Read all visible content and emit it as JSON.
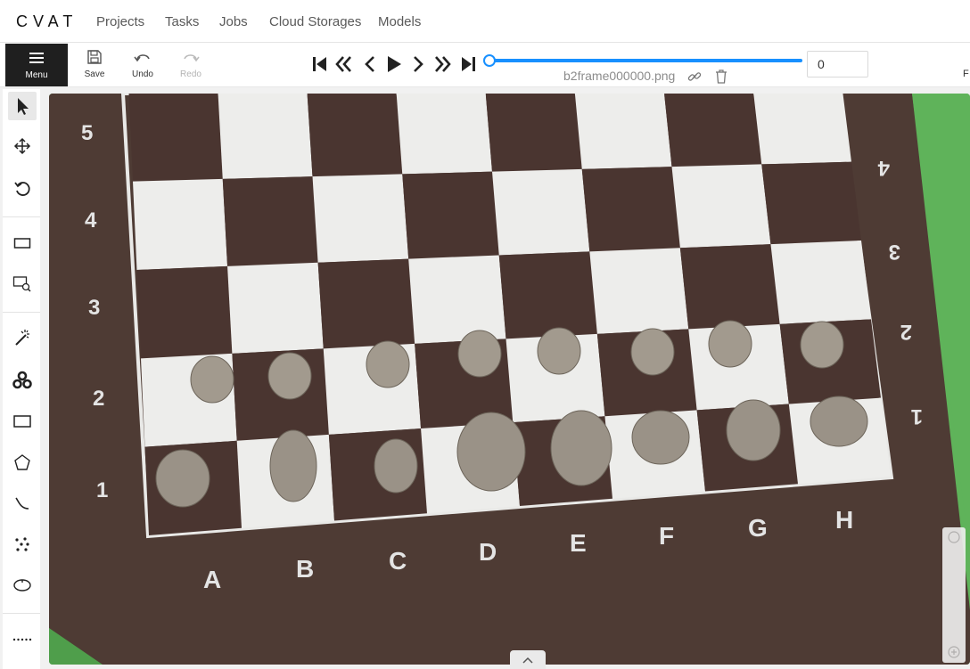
{
  "app": {
    "logo_text": "CVAT"
  },
  "nav": {
    "links": [
      {
        "label": "Projects"
      },
      {
        "label": "Tasks"
      },
      {
        "label": "Jobs"
      },
      {
        "label": "Cloud Storages"
      },
      {
        "label": "Models"
      }
    ]
  },
  "header": {
    "menu_label": "Menu",
    "save_label": "Save",
    "undo_label": "Undo",
    "redo_label": "Redo",
    "filename": "b2frame000000.png",
    "frame_value": "0",
    "cut_text": "F"
  },
  "player": {
    "progress": 0,
    "buttons": [
      "first-frame",
      "backward-step",
      "previous-frame",
      "play",
      "next-frame",
      "forward-step",
      "last-frame"
    ]
  },
  "toolbar": {
    "tools": [
      "cursor",
      "move",
      "rotate",
      "fit",
      "zoom-region",
      "magic-wand",
      "opencv",
      "rectangle",
      "polygon",
      "polyline",
      "points",
      "ellipse",
      "more"
    ]
  },
  "board": {
    "left_ranks": [
      "5",
      "4",
      "3",
      "2",
      "1"
    ],
    "right_ranks": [
      "4",
      "3",
      "2",
      "1"
    ],
    "files": [
      "A",
      "B",
      "C",
      "D",
      "E",
      "F",
      "G",
      "H"
    ]
  },
  "colors": {
    "accent": "#1890ff",
    "menu_bg": "#1f1f1f",
    "table_green": "#5fb35a",
    "board_frame": "#4e3b34",
    "dark_square": "#4a3530",
    "light_square": "#ededeb"
  }
}
